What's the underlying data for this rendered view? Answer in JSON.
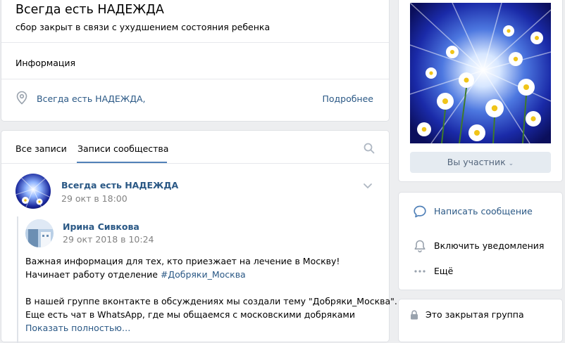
{
  "group": {
    "name": "Всегда есть НАДЕЖДА",
    "status": "сбор закрыт в связи с ухудшением состояния ребенка",
    "info_label": "Информация",
    "address": "Всегда есть НАДЕЖДА,",
    "more_link": "Подробнее"
  },
  "wall": {
    "tabs": [
      {
        "label": "Все записи",
        "active": false
      },
      {
        "label": "Записи сообщества",
        "active": true
      }
    ],
    "post": {
      "author": "Всегда есть НАДЕЖДА",
      "date": "29 окт в 18:00",
      "repost": {
        "author": "Ирина Сивкова",
        "date": "29 окт 2018 в 10:24",
        "line1": "Важная информация для тех, кто приезжает на лечение в Москву!",
        "line2_prefix": "Начинает работу отделение ",
        "line2_hashtag": "#Добряки_Москва",
        "line3": "В нашей группе вконтакте в обсуждениях мы создали тему \"Добряки_Москва\".",
        "line4": "Еще есть чат в WhatsApp, где мы общаемся с московскими добряками",
        "show_more": "Показать полностью…"
      }
    }
  },
  "sidebar": {
    "member_button": "Вы участник",
    "actions": [
      {
        "label": "Написать сообщение",
        "icon": "message-icon"
      },
      {
        "label": "Включить уведомления",
        "icon": "bell-icon"
      },
      {
        "label": "Ещё",
        "icon": "more-icon"
      }
    ],
    "closed_group": "Это закрытая группа"
  },
  "colors": {
    "link": "#2a5885",
    "accent": "#5181b8",
    "page_bg": "#edeef0",
    "muted": "#828282",
    "icon": "#99a2ad"
  }
}
